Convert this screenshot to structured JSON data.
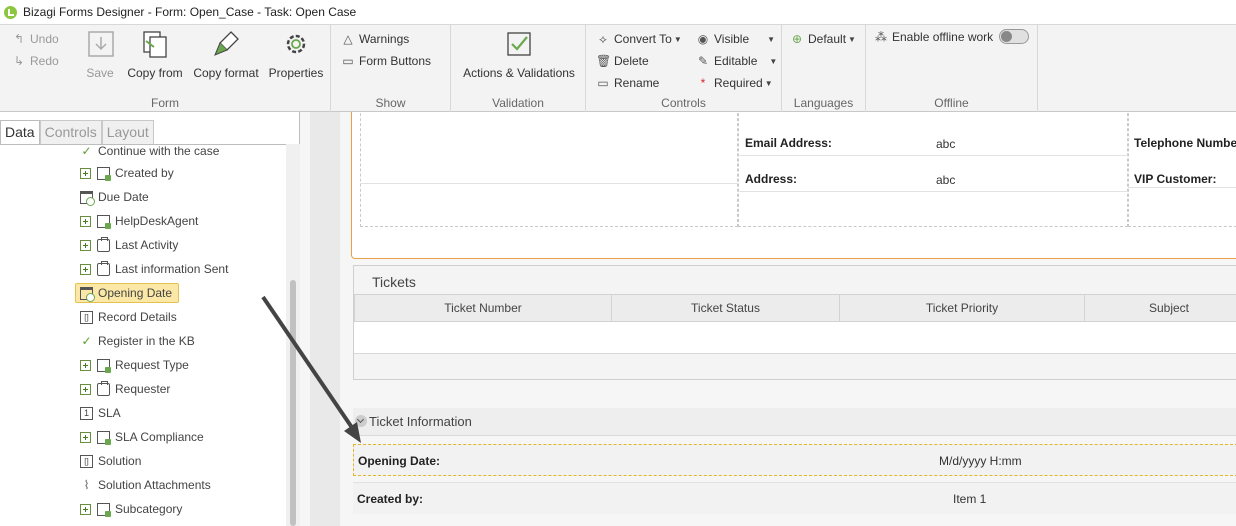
{
  "window": {
    "title": "Bizagi Forms Designer  - Form: Open_Case - Task:  Open Case"
  },
  "ribbon": {
    "undo": "Undo",
    "redo": "Redo",
    "save": "Save",
    "copy_from": "Copy from",
    "copy_format": "Copy format",
    "properties": "Properties",
    "form_group": "Form",
    "warnings": "Warnings",
    "form_buttons": "Form Buttons",
    "show_group": "Show",
    "actions_validations": "Actions & Validations",
    "validation_group": "Validation",
    "convert_to": "Convert To",
    "delete": "Delete",
    "rename": "Rename",
    "visible": "Visible",
    "editable": "Editable",
    "required": "Required",
    "controls_group": "Controls",
    "default_lang": "Default",
    "languages_group": "Languages",
    "enable_offline": "Enable offline work",
    "offline_group": "Offline"
  },
  "tabs": [
    "Data",
    "Controls",
    "Layout"
  ],
  "tree": [
    {
      "label": "Continue with the case",
      "icon": "check",
      "expandable": false
    },
    {
      "label": "Created by",
      "icon": "form",
      "expandable": true
    },
    {
      "label": "Due Date",
      "icon": "cal",
      "expandable": false
    },
    {
      "label": "HelpDeskAgent",
      "icon": "form",
      "expandable": true
    },
    {
      "label": "Last Activity",
      "icon": "brief",
      "expandable": true
    },
    {
      "label": "Last information Sent",
      "icon": "brief",
      "expandable": true
    },
    {
      "label": "Opening Date",
      "icon": "cal",
      "expandable": false,
      "selected": true
    },
    {
      "label": "Record Details",
      "icon": "rec",
      "expandable": false
    },
    {
      "label": "Register in the KB",
      "icon": "check",
      "expandable": false
    },
    {
      "label": "Request Type",
      "icon": "form",
      "expandable": true
    },
    {
      "label": "Requester",
      "icon": "brief",
      "expandable": true
    },
    {
      "label": "SLA",
      "icon": "num",
      "expandable": false
    },
    {
      "label": "SLA Compliance",
      "icon": "form",
      "expandable": true
    },
    {
      "label": "Solution",
      "icon": "rec",
      "expandable": false
    },
    {
      "label": "Solution Attachments",
      "icon": "clip",
      "expandable": false
    },
    {
      "label": "Subcategory",
      "icon": "form",
      "expandable": true
    }
  ],
  "form": {
    "email_label": "Email Address:",
    "email_value": "abc",
    "address_label": "Address:",
    "address_value": "abc",
    "telephone_label": "Telephone Numbe",
    "vip_label": "VIP Customer:",
    "tickets_title": "Tickets",
    "tickets_columns": [
      "Ticket Number",
      "Ticket Status",
      "Ticket Priority",
      "Subject"
    ],
    "ticket_info_title": "Ticket Information",
    "opening_label": "Opening Date:",
    "opening_value": "M/d/yyyy H:mm",
    "created_label": "Created by:",
    "created_value": "Item 1"
  }
}
